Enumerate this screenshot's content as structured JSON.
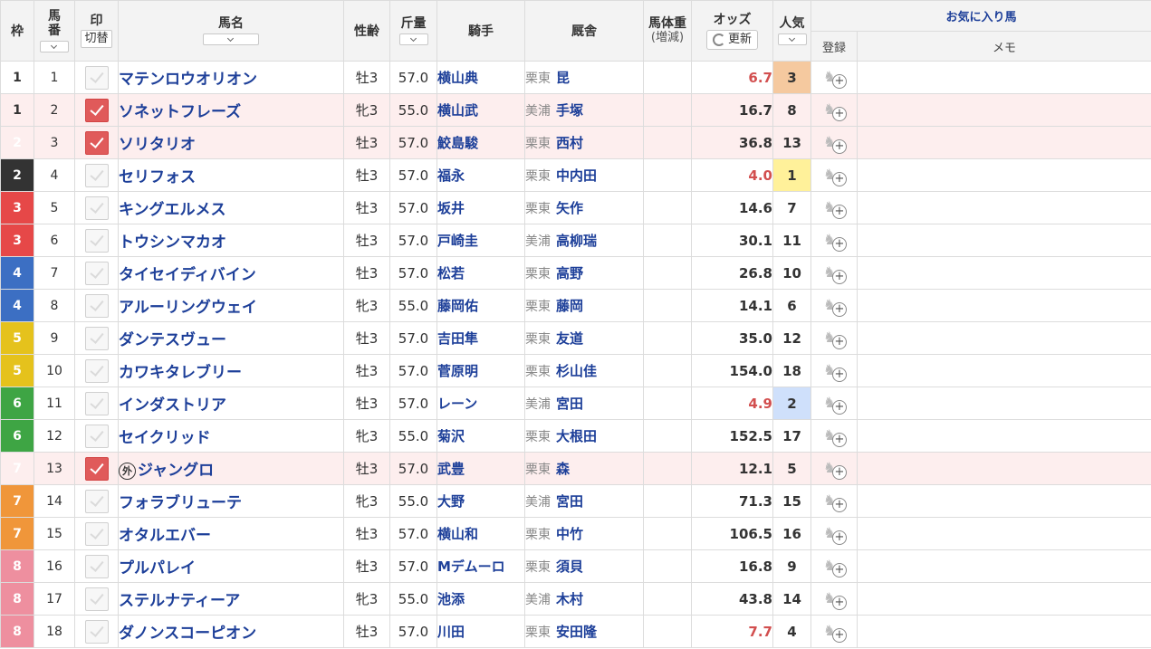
{
  "header": {
    "waku": "枠",
    "umaban_top": "馬",
    "umaban_bottom": "番",
    "mark": "印",
    "mark_switch": "切替",
    "name": "馬名",
    "sexage": "性齢",
    "weight": "斤量",
    "jockey": "騎手",
    "stable": "厩舎",
    "body_weight": "馬体重",
    "body_weight_sub": "(増減)",
    "odds": "オッズ",
    "odds_refresh": "更新",
    "popularity": "人気",
    "favorites": "お気に入り馬",
    "register": "登録",
    "memo": "メモ"
  },
  "colors": {
    "link": "#1d3f99",
    "hot_odds": "#d24f4f",
    "pop1": "#fff19a",
    "pop2": "#cfe0fb",
    "pop3": "#f5c99f",
    "checked": "#e05a5a",
    "marked_row": "#fdeeee"
  },
  "icons": {
    "favorite_add": "horse-plus-icon",
    "refresh": "refresh-icon",
    "check": "check-icon",
    "sort": "chevron-down-icon"
  },
  "rows": [
    {
      "waku": "1",
      "umaban": "1",
      "checked": false,
      "foreign": false,
      "name": "マテンロウオリオン",
      "sexage": "牡3",
      "weight": "57.0",
      "jockey": "横山典",
      "region": "栗東",
      "trainer": "昆",
      "odds": "6.7",
      "hot": true,
      "pop": "3"
    },
    {
      "waku": "1",
      "umaban": "2",
      "checked": true,
      "foreign": false,
      "name": "ソネットフレーズ",
      "sexage": "牝3",
      "weight": "55.0",
      "jockey": "横山武",
      "region": "美浦",
      "trainer": "手塚",
      "odds": "16.7",
      "hot": false,
      "pop": "8"
    },
    {
      "waku": "2",
      "umaban": "3",
      "checked": true,
      "foreign": false,
      "name": "ソリタリオ",
      "sexage": "牡3",
      "weight": "57.0",
      "jockey": "鮫島駿",
      "region": "栗東",
      "trainer": "西村",
      "odds": "36.8",
      "hot": false,
      "pop": "13"
    },
    {
      "waku": "2",
      "umaban": "4",
      "checked": false,
      "foreign": false,
      "name": "セリフォス",
      "sexage": "牡3",
      "weight": "57.0",
      "jockey": "福永",
      "region": "栗東",
      "trainer": "中内田",
      "odds": "4.0",
      "hot": true,
      "pop": "1"
    },
    {
      "waku": "3",
      "umaban": "5",
      "checked": false,
      "foreign": false,
      "name": "キングエルメス",
      "sexage": "牡3",
      "weight": "57.0",
      "jockey": "坂井",
      "region": "栗東",
      "trainer": "矢作",
      "odds": "14.6",
      "hot": false,
      "pop": "7"
    },
    {
      "waku": "3",
      "umaban": "6",
      "checked": false,
      "foreign": false,
      "name": "トウシンマカオ",
      "sexage": "牡3",
      "weight": "57.0",
      "jockey": "戸崎圭",
      "region": "美浦",
      "trainer": "高柳瑞",
      "odds": "30.1",
      "hot": false,
      "pop": "11"
    },
    {
      "waku": "4",
      "umaban": "7",
      "checked": false,
      "foreign": false,
      "name": "タイセイディバイン",
      "sexage": "牡3",
      "weight": "57.0",
      "jockey": "松若",
      "region": "栗東",
      "trainer": "高野",
      "odds": "26.8",
      "hot": false,
      "pop": "10"
    },
    {
      "waku": "4",
      "umaban": "8",
      "checked": false,
      "foreign": false,
      "name": "アルーリングウェイ",
      "sexage": "牝3",
      "weight": "55.0",
      "jockey": "藤岡佑",
      "region": "栗東",
      "trainer": "藤岡",
      "odds": "14.1",
      "hot": false,
      "pop": "6"
    },
    {
      "waku": "5",
      "umaban": "9",
      "checked": false,
      "foreign": false,
      "name": "ダンテスヴュー",
      "sexage": "牡3",
      "weight": "57.0",
      "jockey": "吉田隼",
      "region": "栗東",
      "trainer": "友道",
      "odds": "35.0",
      "hot": false,
      "pop": "12"
    },
    {
      "waku": "5",
      "umaban": "10",
      "checked": false,
      "foreign": false,
      "name": "カワキタレブリー",
      "sexage": "牡3",
      "weight": "57.0",
      "jockey": "菅原明",
      "region": "栗東",
      "trainer": "杉山佳",
      "odds": "154.0",
      "hot": false,
      "pop": "18"
    },
    {
      "waku": "6",
      "umaban": "11",
      "checked": false,
      "foreign": false,
      "name": "インダストリア",
      "sexage": "牡3",
      "weight": "57.0",
      "jockey": "レーン",
      "region": "美浦",
      "trainer": "宮田",
      "odds": "4.9",
      "hot": true,
      "pop": "2"
    },
    {
      "waku": "6",
      "umaban": "12",
      "checked": false,
      "foreign": false,
      "name": "セイクリッド",
      "sexage": "牝3",
      "weight": "55.0",
      "jockey": "菊沢",
      "region": "栗東",
      "trainer": "大根田",
      "odds": "152.5",
      "hot": false,
      "pop": "17"
    },
    {
      "waku": "7",
      "umaban": "13",
      "checked": true,
      "foreign": true,
      "foreign_mark": "外",
      "name": "ジャングロ",
      "sexage": "牡3",
      "weight": "57.0",
      "jockey": "武豊",
      "region": "栗東",
      "trainer": "森",
      "odds": "12.1",
      "hot": false,
      "pop": "5"
    },
    {
      "waku": "7",
      "umaban": "14",
      "checked": false,
      "foreign": false,
      "name": "フォラブリューテ",
      "sexage": "牝3",
      "weight": "55.0",
      "jockey": "大野",
      "region": "美浦",
      "trainer": "宮田",
      "odds": "71.3",
      "hot": false,
      "pop": "15"
    },
    {
      "waku": "7",
      "umaban": "15",
      "checked": false,
      "foreign": false,
      "name": "オタルエバー",
      "sexage": "牡3",
      "weight": "57.0",
      "jockey": "横山和",
      "region": "栗東",
      "trainer": "中竹",
      "odds": "106.5",
      "hot": false,
      "pop": "16"
    },
    {
      "waku": "8",
      "umaban": "16",
      "checked": false,
      "foreign": false,
      "name": "プルパレイ",
      "sexage": "牡3",
      "weight": "57.0",
      "jockey": "Mデムーロ",
      "region": "栗東",
      "trainer": "須貝",
      "odds": "16.8",
      "hot": false,
      "pop": "9"
    },
    {
      "waku": "8",
      "umaban": "17",
      "checked": false,
      "foreign": false,
      "name": "ステルナティーア",
      "sexage": "牝3",
      "weight": "55.0",
      "jockey": "池添",
      "region": "美浦",
      "trainer": "木村",
      "odds": "43.8",
      "hot": false,
      "pop": "14"
    },
    {
      "waku": "8",
      "umaban": "18",
      "checked": false,
      "foreign": false,
      "name": "ダノンスコーピオン",
      "sexage": "牡3",
      "weight": "57.0",
      "jockey": "川田",
      "region": "栗東",
      "trainer": "安田隆",
      "odds": "7.7",
      "hot": true,
      "pop": "4"
    }
  ]
}
